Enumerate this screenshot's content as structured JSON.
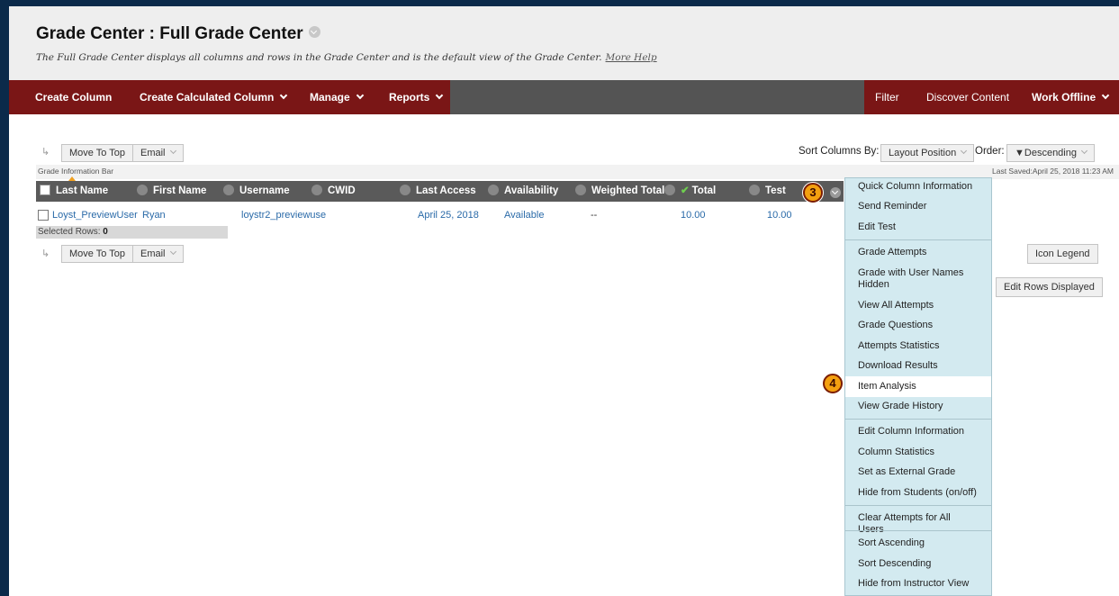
{
  "header": {
    "title": "Grade Center : Full Grade Center",
    "description": "The Full Grade Center displays all columns and rows in the Grade Center and is the default view of the Grade Center.",
    "help_link": "More Help"
  },
  "action_bar": {
    "create_column": "Create Column",
    "create_calculated_column": "Create Calculated Column",
    "manage": "Manage",
    "reports": "Reports",
    "filter": "Filter",
    "discover_content": "Discover Content",
    "work_offline": "Work Offline"
  },
  "toolbar": {
    "move_to_top": "Move To Top",
    "email": "Email",
    "sort_columns_by_label": "Sort Columns By:",
    "sort_value": "Layout Position",
    "order_label": "Order:",
    "order_value": "▼Descending"
  },
  "info_bar": {
    "label": "Grade Information Bar",
    "last_saved": "Last Saved:April 25, 2018 11:23 AM"
  },
  "grid": {
    "columns": [
      "Last Name",
      "First Name",
      "Username",
      "CWID",
      "Last Access",
      "Availability",
      "Weighted Total",
      "Total",
      "Test"
    ],
    "row": {
      "last_name": "Loyst_PreviewUser",
      "first_name": "Ryan",
      "username": "loystr2_previewuse",
      "cwid": "",
      "last_access": "April 25, 2018",
      "availability": "Available",
      "weighted_total": "--",
      "total": "10.00",
      "test": "10.00"
    },
    "selected_rows_label": "Selected Rows:",
    "selected_rows_count": "0"
  },
  "side_buttons": {
    "icon_legend": "Icon Legend",
    "edit_rows_displayed": "Edit Rows Displayed"
  },
  "badges": {
    "step3": "3",
    "step4": "4"
  },
  "menu": {
    "groups": [
      [
        "Quick Column Information",
        "Send Reminder",
        "Edit Test"
      ],
      [
        "Grade Attempts",
        "Grade with User Names Hidden",
        "View All Attempts",
        "Grade Questions",
        "Attempts Statistics",
        "Download Results",
        "Item Analysis",
        "View Grade History"
      ],
      [
        "Edit Column Information",
        "Column Statistics",
        "Set as External Grade",
        "Hide from Students (on/off)"
      ],
      [
        "Clear Attempts for All Users"
      ],
      [
        "Sort Ascending",
        "Sort Descending",
        "Hide from Instructor View"
      ]
    ],
    "highlighted": "Item Analysis"
  },
  "colors": {
    "action_bar": "#7a1616",
    "action_bar_mid": "#545454",
    "grid_header": "#5a5a5a",
    "menu_bg": "#d3eaf0",
    "link": "#2a6aa8",
    "badge": "#f4a010"
  }
}
